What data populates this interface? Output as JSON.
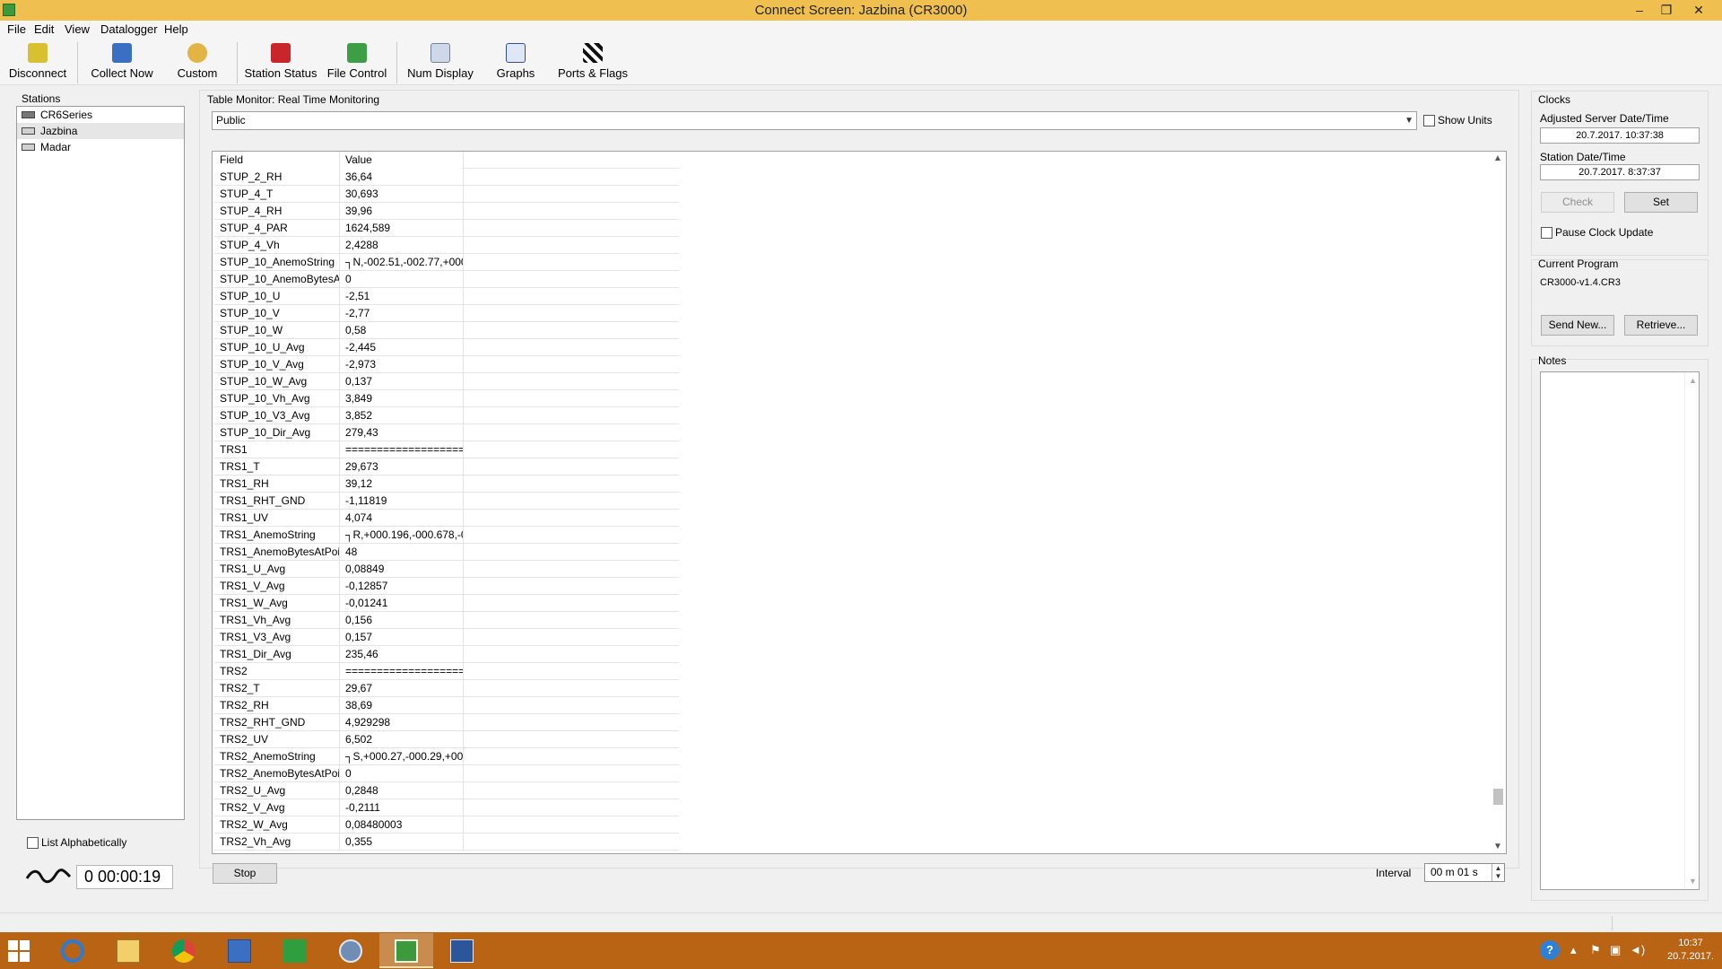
{
  "window": {
    "title": "Connect Screen: Jazbina (CR3000)",
    "minimize": "‒",
    "restore": "❐",
    "close": "✕"
  },
  "menu": [
    "File",
    "Edit",
    "View",
    "Datalogger",
    "Help"
  ],
  "toolbar": {
    "disconnect": "Disconnect",
    "collect_now": "Collect Now",
    "custom": "Custom",
    "station_status": "Station Status",
    "file_control": "File Control",
    "num_display": "Num Display",
    "graphs": "Graphs",
    "ports_flags": "Ports & Flags"
  },
  "stations": {
    "title": "Stations",
    "items": [
      {
        "label": "CR6Series",
        "selected": false
      },
      {
        "label": "Jazbina",
        "selected": true
      },
      {
        "label": "Madar",
        "selected": false
      }
    ],
    "list_alphabetically": "List Alphabetically",
    "elapsed": "0 00:00:19"
  },
  "table_monitor": {
    "title": "Table Monitor: Real Time Monitoring",
    "selected_table": "Public",
    "show_units": "Show Units",
    "columns": [
      "Field",
      "Value"
    ],
    "rows": [
      [
        "STUP_2_RH",
        "36,64"
      ],
      [
        "STUP_4_T",
        "30,693"
      ],
      [
        "STUP_4_RH",
        "39,96"
      ],
      [
        "STUP_4_PAR",
        "1624,589"
      ],
      [
        "STUP_4_Vh",
        "2,4288"
      ],
      [
        "STUP_10_AnemoString",
        "┐N,-002.51,-002.77,+000"
      ],
      [
        "STUP_10_AnemoBytesA",
        "0"
      ],
      [
        "STUP_10_U",
        "-2,51"
      ],
      [
        "STUP_10_V",
        "-2,77"
      ],
      [
        "STUP_10_W",
        "0,58"
      ],
      [
        "STUP_10_U_Avg",
        "-2,445"
      ],
      [
        "STUP_10_V_Avg",
        "-2,973"
      ],
      [
        "STUP_10_W_Avg",
        "0,137"
      ],
      [
        "STUP_10_Vh_Avg",
        "3,849"
      ],
      [
        "STUP_10_V3_Avg",
        "3,852"
      ],
      [
        "STUP_10_Dir_Avg",
        "279,43"
      ],
      [
        "TRS1",
        "===================="
      ],
      [
        "TRS1_T",
        "29,673"
      ],
      [
        "TRS1_RH",
        "39,12"
      ],
      [
        "TRS1_RHT_GND",
        "-1,11819"
      ],
      [
        "TRS1_UV",
        "4,074"
      ],
      [
        "TRS1_AnemoString",
        "┐R,+000.196,-000.678,-0"
      ],
      [
        "TRS1_AnemoBytesAtPoi",
        "48"
      ],
      [
        "TRS1_U_Avg",
        "0,08849"
      ],
      [
        "TRS1_V_Avg",
        "-0,12857"
      ],
      [
        "TRS1_W_Avg",
        "-0,01241"
      ],
      [
        "TRS1_Vh_Avg",
        "0,156"
      ],
      [
        "TRS1_V3_Avg",
        "0,157"
      ],
      [
        "TRS1_Dir_Avg",
        "235,46"
      ],
      [
        "TRS2",
        "===================="
      ],
      [
        "TRS2_T",
        "29,67"
      ],
      [
        "TRS2_RH",
        "38,69"
      ],
      [
        "TRS2_RHT_GND",
        "4,929298"
      ],
      [
        "TRS2_UV",
        "6,502"
      ],
      [
        "TRS2_AnemoString",
        "┐S,+000.27,-000.29,+000"
      ],
      [
        "TRS2_AnemoBytesAtPoi",
        "0"
      ],
      [
        "TRS2_U_Avg",
        "0,2848"
      ],
      [
        "TRS2_V_Avg",
        "-0,2111"
      ],
      [
        "TRS2_W_Avg",
        "0,08480003"
      ],
      [
        "TRS2_Vh_Avg",
        "0,355"
      ]
    ],
    "stop": "Stop",
    "interval_label": "Interval",
    "interval_value": "00 m 01 s"
  },
  "clocks": {
    "title": "Clocks",
    "server_label": "Adjusted Server Date/Time",
    "server_value": "20.7.2017. 10:37:38",
    "station_label": "Station Date/Time",
    "station_value": "20.7.2017. 8:37:37",
    "check": "Check",
    "set": "Set",
    "pause": "Pause Clock Update"
  },
  "program": {
    "title": "Current Program",
    "name": "CR3000-v1.4.CR3",
    "send_new": "Send New...",
    "retrieve": "Retrieve..."
  },
  "notes": {
    "title": "Notes"
  },
  "taskbar": {
    "time": "10:37",
    "date": "20.7.2017.",
    "help": "?"
  },
  "colors": {
    "titlebar": "#efc04f",
    "taskbar": "#b96414"
  }
}
